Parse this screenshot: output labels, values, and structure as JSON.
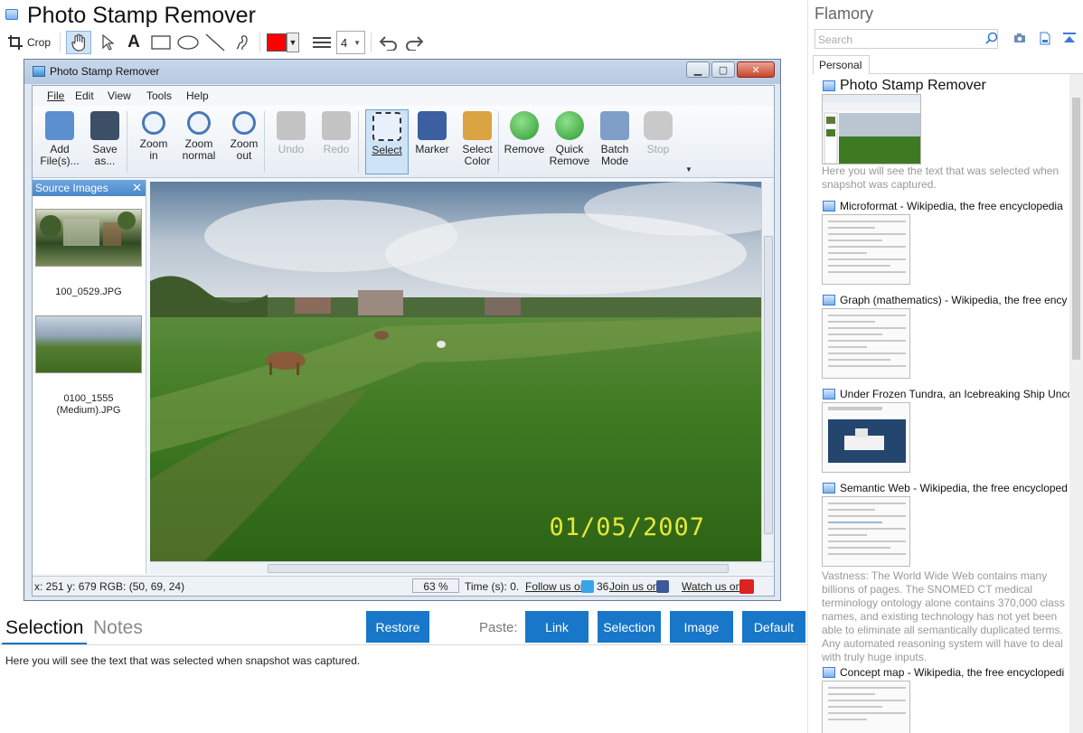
{
  "editor": {
    "title": "Photo Stamp Remover",
    "tools": {
      "crop_label": "Crop",
      "text_tool_glyph": "A",
      "line_width_value": "4",
      "color": "#ff0000"
    }
  },
  "screenshot": {
    "window_title": "Photo Stamp Remover",
    "menu": [
      "File",
      "Edit",
      "View",
      "Tools",
      "Help"
    ],
    "ribbon": [
      {
        "label": "Add\nFile(s)...",
        "icon": "add-files-icon",
        "enabled": true
      },
      {
        "label": "Save\nas...",
        "icon": "save-icon",
        "enabled": true
      },
      {
        "label": "Zoom\nin",
        "icon": "zoom-in-icon",
        "enabled": true
      },
      {
        "label": "Zoom\nnormal",
        "icon": "zoom-normal-icon",
        "enabled": true
      },
      {
        "label": "Zoom\nout",
        "icon": "zoom-out-icon",
        "enabled": true
      },
      {
        "label": "Undo",
        "icon": "undo-icon",
        "enabled": false
      },
      {
        "label": "Redo",
        "icon": "redo-icon",
        "enabled": false
      },
      {
        "label": "Select",
        "icon": "select-icon",
        "enabled": true,
        "selected": true
      },
      {
        "label": "Marker",
        "icon": "marker-icon",
        "enabled": true
      },
      {
        "label": "Select\nColor",
        "icon": "palette-icon",
        "enabled": true
      },
      {
        "label": "Remove",
        "icon": "remove-icon",
        "enabled": true
      },
      {
        "label": "Quick\nRemove",
        "icon": "quick-remove-icon",
        "enabled": true
      },
      {
        "label": "Batch\nMode",
        "icon": "batch-mode-icon",
        "enabled": true
      },
      {
        "label": "Stop",
        "icon": "stop-icon",
        "enabled": false
      }
    ],
    "source_images_header": "Source Images",
    "source_images": [
      {
        "name": "100_0529.JPG"
      },
      {
        "name": "0100_1555\n(Medium).JPG"
      }
    ],
    "photo_datestamp": "01/05/2007",
    "status": {
      "coords": "x: 251 y: 679  RGB: (50, 69, 24)",
      "zoom": "63 %",
      "time": "Time (s): 0.",
      "follow": "Follow us on",
      "join_prefix": "36",
      "join": "Join us on",
      "watch": "Watch us on"
    }
  },
  "bottom": {
    "tabs": [
      "Selection",
      "Notes"
    ],
    "restore_label": "Restore",
    "paste_label": "Paste:",
    "paste_buttons": [
      "Link",
      "Selection",
      "Image",
      "Default"
    ],
    "selection_text": "Here you will see the text that was selected when snapshot was captured."
  },
  "sidebar": {
    "brand": "Flamory",
    "search_placeholder": "Search",
    "tab": "Personal",
    "items": [
      {
        "title": "Photo Stamp Remover",
        "desc": "Here you will see the text that was selected when snapshot was captured."
      },
      {
        "title": "Microformat - Wikipedia, the free encyclopedia"
      },
      {
        "title": "Graph (mathematics) - Wikipedia, the free ency"
      },
      {
        "title": "Under Frozen Tundra, an Icebreaking Ship Unco"
      },
      {
        "title": "Semantic Web - Wikipedia, the free encycloped",
        "desc": "Vastness: The World Wide Web contains many billions of pages. The SNOMED CT medical terminology ontology alone contains 370,000 class names, and existing technology has not yet been able to eliminate all semantically duplicated terms. Any automated reasoning system will have to deal with truly huge inputs."
      },
      {
        "title": "Concept map - Wikipedia, the free encyclopedi"
      }
    ]
  },
  "colors": {
    "accent": "#1877c9",
    "datestamp": "#e7e63a"
  }
}
